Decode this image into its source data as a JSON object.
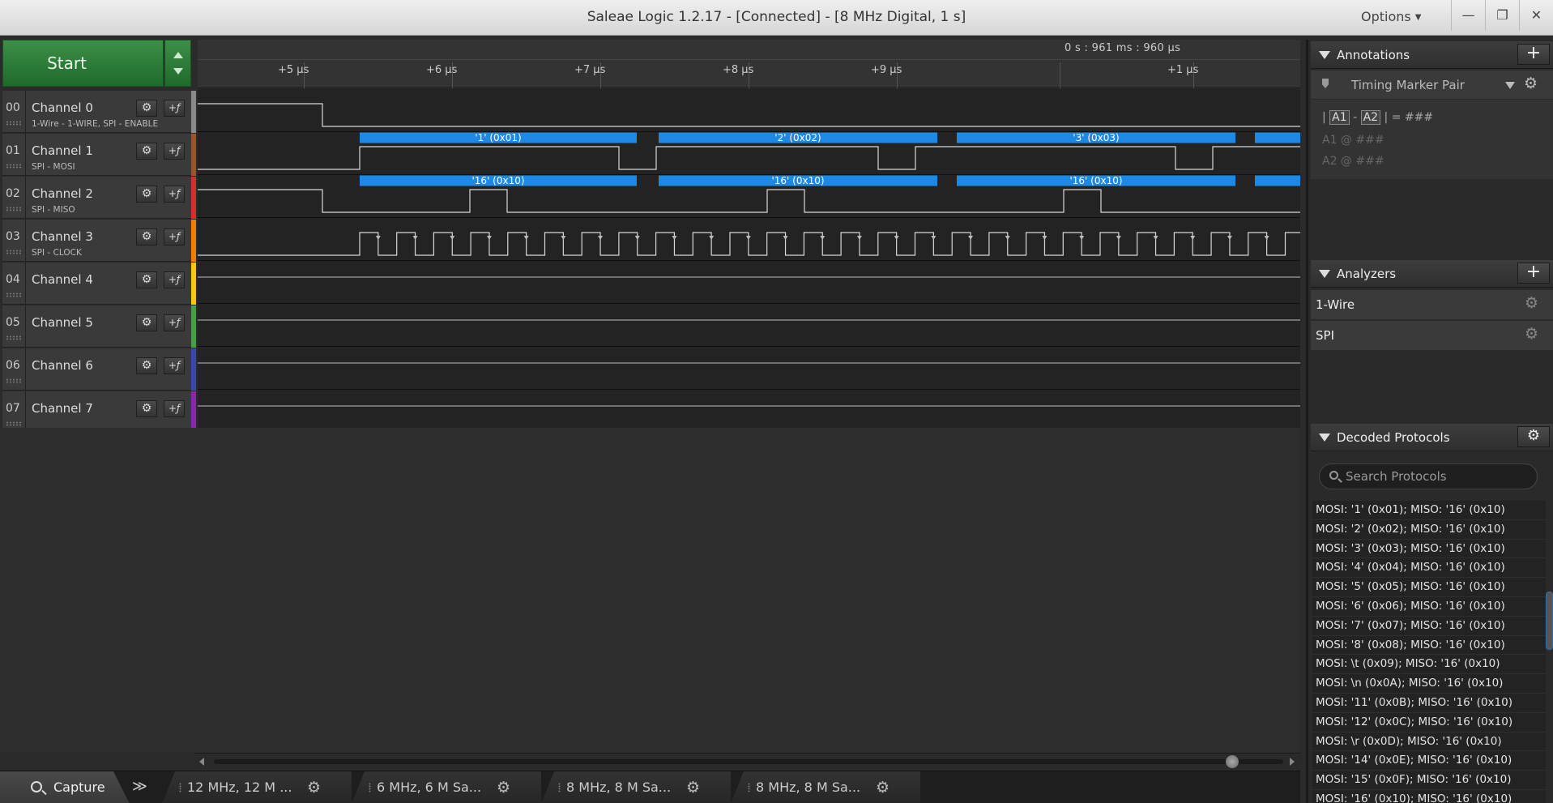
{
  "window": {
    "title": "Saleae Logic 1.2.17 - [Connected] - [8 MHz Digital, 1 s]",
    "options_label": "Options",
    "minimize": "—",
    "restore": "❐",
    "close": "✕"
  },
  "start": {
    "label": "Start"
  },
  "ruler": {
    "absolute_time": "0 s : 961 ms : 960 μs",
    "ticks": [
      "+5 μs",
      "+6 μs",
      "+7 μs",
      "+8 μs",
      "+9 μs",
      "+1 μs"
    ]
  },
  "channels": [
    {
      "num": "00",
      "name": "Channel 0",
      "sub": "1-Wire - 1-WIRE, SPI - ENABLE",
      "color": "#8a8a8a"
    },
    {
      "num": "01",
      "name": "Channel 1",
      "sub": "SPI - MOSI",
      "color": "#a0522d"
    },
    {
      "num": "02",
      "name": "Channel 2",
      "sub": "SPI - MISO",
      "color": "#d32f2f"
    },
    {
      "num": "03",
      "name": "Channel 3",
      "sub": "SPI - CLOCK",
      "color": "#f57c00"
    },
    {
      "num": "04",
      "name": "Channel 4",
      "sub": "",
      "color": "#f9c80e"
    },
    {
      "num": "05",
      "name": "Channel 5",
      "sub": "",
      "color": "#43a047"
    },
    {
      "num": "06",
      "name": "Channel 6",
      "sub": "",
      "color": "#3949ab"
    },
    {
      "num": "07",
      "name": "Channel 7",
      "sub": "",
      "color": "#8e24aa"
    }
  ],
  "icons": {
    "gear": "gear-icon",
    "trigger": "trigger-icon"
  },
  "decode": {
    "mosi": [
      "'1' (0x01)",
      "'2' (0x02)",
      "'3' (0x03)"
    ],
    "miso": [
      "'16' (0x10)",
      "'16' (0x10)",
      "'16' (0x10)"
    ],
    "bubble_color": "#1e88e5"
  },
  "bottom_tabs": {
    "capture": "Capture",
    "more": "≫",
    "sessions": [
      "12 MHz, 12 M ...",
      "6 MHz, 6 M Sa...",
      "8 MHz, 8 M Sa...",
      "8 MHz, 8 M Sa..."
    ]
  },
  "annotations": {
    "title": "Annotations",
    "add": "+",
    "marker_pair": "Timing Marker Pair",
    "a1": "A1",
    "a2": "A2",
    "delta_value": "###",
    "a1_at": "A1  @  ###",
    "a2_at": "A2  @  ###"
  },
  "analyzers": {
    "title": "Analyzers",
    "add": "+",
    "items": [
      "1-Wire",
      "SPI"
    ]
  },
  "decoded": {
    "title": "Decoded Protocols",
    "search_placeholder": "Search Protocols",
    "items": [
      "MOSI: '1' (0x01);  MISO: '16' (0x10)",
      "MOSI: '2' (0x02);  MISO: '16' (0x10)",
      "MOSI: '3' (0x03);  MISO: '16' (0x10)",
      "MOSI: '4' (0x04);  MISO: '16' (0x10)",
      "MOSI: '5' (0x05);  MISO: '16' (0x10)",
      "MOSI: '6' (0x06);  MISO: '16' (0x10)",
      "MOSI: '7' (0x07);  MISO: '16' (0x10)",
      "MOSI: '8' (0x08);  MISO: '16' (0x10)",
      "MOSI: \\t (0x09);  MISO: '16' (0x10)",
      "MOSI: \\n (0x0A);  MISO: '16' (0x10)",
      "MOSI: '11' (0x0B);  MISO: '16' (0x10)",
      "MOSI: '12' (0x0C);  MISO: '16' (0x10)",
      "MOSI: \\r (0x0D);  MISO: '16' (0x10)",
      "MOSI: '14' (0x0E);  MISO: '16' (0x10)",
      "MOSI: '15' (0x0F);  MISO: '16' (0x10)",
      "MOSI: '16' (0x10);  MISO: '16' (0x10)"
    ]
  }
}
